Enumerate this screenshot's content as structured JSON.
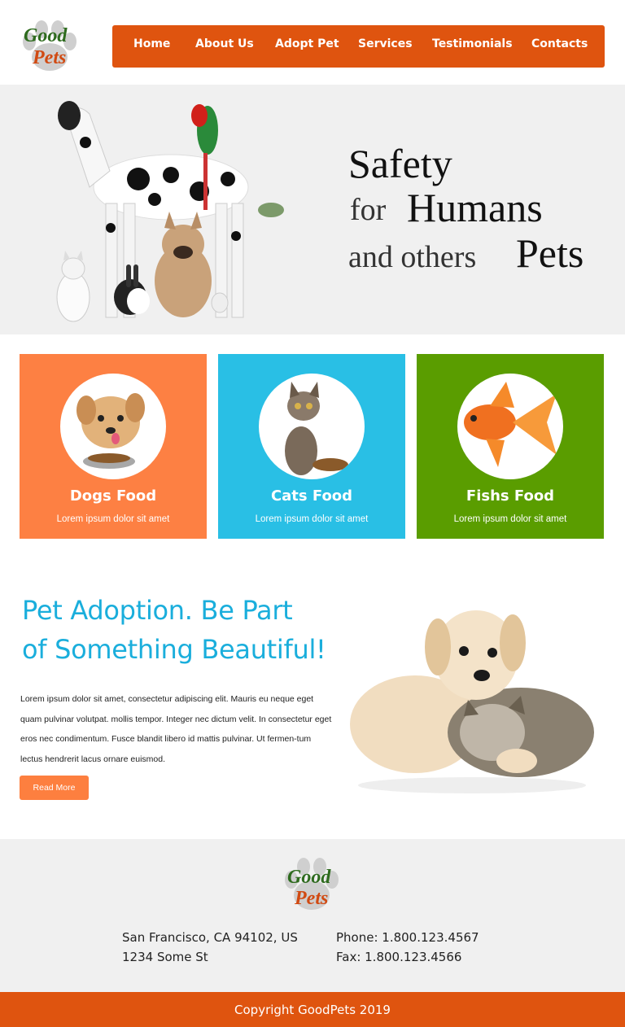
{
  "brand": {
    "logo_word1": "Good",
    "logo_word2": "Pets",
    "primary_color": "#df540f",
    "accent_blue": "#1aaedc"
  },
  "nav": {
    "items": [
      "Home",
      "About Us",
      "Adopt Pet",
      "Services",
      "Testimonials",
      "Contacts"
    ]
  },
  "hero": {
    "line1": "Safety",
    "line2a": "for",
    "line2b": "Humans",
    "line3a": "and others",
    "line3b": "Pets"
  },
  "cards": [
    {
      "title": "Dogs Food",
      "subtitle": "Lorem ipsum dolor sit amet",
      "color": "#fd8043"
    },
    {
      "title": "Cats Food",
      "subtitle": "Lorem ipsum dolor sit amet",
      "color": "#29bfe5"
    },
    {
      "title": "Fishs Food",
      "subtitle": "Lorem ipsum dolor sit amet",
      "color": "#5a9d00"
    }
  ],
  "adoption": {
    "title_line1": "Pet Adoption. Be Part",
    "title_line2": "of Something Beautiful!",
    "body": "Lorem ipsum dolor sit amet, consectetur adipiscing elit. Mauris eu neque eget quam pulvinar volutpat. mollis tempor. Integer nec dictum velit. In consectetur eget eros nec condimentum. Fusce blandit libero id mattis pulvinar. Ut fermen-tum lectus hendrerit lacus ornare euismod.",
    "button_label": "Read More"
  },
  "footer": {
    "address_line1": "San Francisco, CA 94102, US",
    "address_line2": "1234 Some St",
    "phone": "Phone: 1.800.123.4567",
    "fax": "Fax: 1.800.123.4566",
    "copyright": "Copyright GoodPets 2019"
  }
}
